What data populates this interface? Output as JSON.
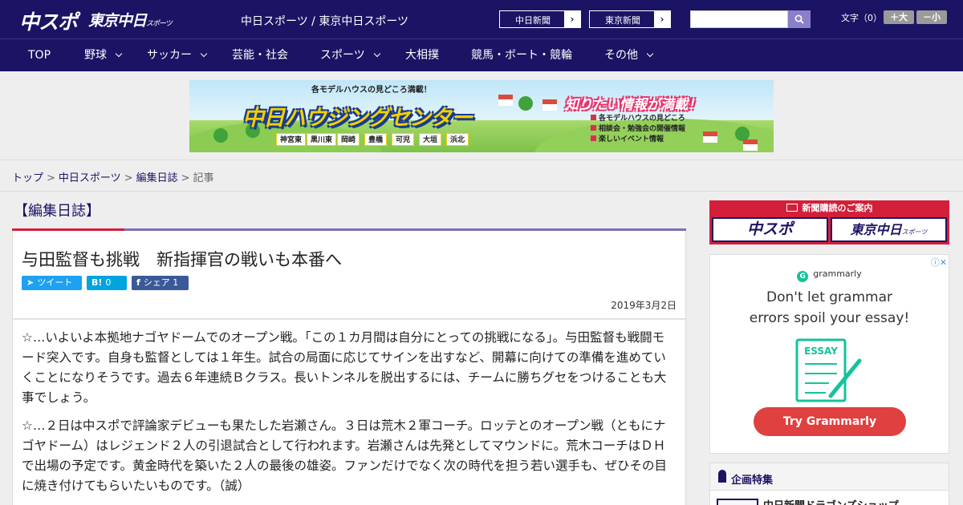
{
  "header": {
    "logo_chuspo": "中スポ",
    "logo_tokyo_main": "東京中日",
    "logo_tokyo_sub": "スポーツ",
    "site_names": "中日スポーツ / 東京中日スポーツ",
    "paper_links": [
      "中日新聞",
      "東京新聞"
    ],
    "search_placeholder": "",
    "font_size_label": "文字（0）",
    "font_up": "＋大",
    "font_down": "－小"
  },
  "nav": {
    "items": [
      {
        "label": "TOP",
        "dropdown": false
      },
      {
        "label": "野球",
        "dropdown": true
      },
      {
        "label": "サッカー",
        "dropdown": true
      },
      {
        "label": "芸能・社会",
        "dropdown": false
      },
      {
        "label": "スポーツ",
        "dropdown": true
      },
      {
        "label": "大相撲",
        "dropdown": false
      },
      {
        "label": "競馬・ボート・競輪",
        "dropdown": false
      },
      {
        "label": "その他",
        "dropdown": true
      }
    ]
  },
  "banner": {
    "top_text": "各モデルハウスの見どころ満載！",
    "title": "中日ハウジングセンター",
    "catch": "知りたい情報が満載！",
    "list": [
      "各モデルハウスの見どころ",
      "相談会・勉強会の開催情報",
      "楽しいイベント情報"
    ],
    "cities": [
      "神宮東",
      "黒川東",
      "岡崎",
      "豊橋",
      "可児",
      "大垣",
      "浜北"
    ]
  },
  "breadcrumb": {
    "items": [
      "トップ",
      "中日スポーツ",
      "編集日誌"
    ],
    "current": "記事",
    "separator": ">"
  },
  "article": {
    "section": "【編集日誌】",
    "title": "与田監督も挑戦　新指揮官の戦いも本番へ",
    "share": {
      "tweet_label": "ツイート",
      "hatena_icon": "B!",
      "hatena_count": "0",
      "facebook_icon": "f",
      "facebook_label": "シェア",
      "facebook_count": "1"
    },
    "date": "2019年3月2日",
    "paragraphs": [
      "☆…いよいよ本拠地ナゴヤドームでのオープン戦。「この１カ月間は自分にとっての挑戦になる」。与田監督も戦闘モード突入です。自身も監督としては１年生。試合の局面に応じてサインを出すなど、開幕に向けての準備を進めていくことになりそうです。過去６年連続Ｂクラス。長いトンネルを脱出するには、チームに勝ちグセをつけることも大事でしょう。",
      "☆…２日は中スポで評論家デビューも果たした岩瀬さん。３日は荒木２軍コーチ。ロッテとのオープン戦（ともにナゴヤドーム）はレジェンド２人の引退試合として行われます。岩瀬さんは先発としてマウンドに。荒木コーチはＤＨで出場の予定です。黄金時代を築いた２人の最後の雄姿。ファンだけでなく次の時代を担う若い選手も、ぜひその目に焼き付けてもらいたいものです。（誠）"
    ]
  },
  "sidebar": {
    "subscribe_head": "新聞購読のご案内",
    "subscribe_links": [
      "中スポ",
      "東京中日"
    ],
    "subscribe_sub": "スポーツ",
    "ad": {
      "brand": "grammarly",
      "headline_1": "Don't let grammar",
      "headline_2": "errors spoil your essay!",
      "illust_text": "ESSAY",
      "cta": "Try Grammarly"
    },
    "feature_title": "企画特集",
    "feature_item": "中日新聞ドラゴンズショップ"
  },
  "colors": {
    "header_bg": "#1b1464",
    "accent_red": "#d31f3a",
    "section_line": "#7a71b5",
    "twitter": "#1da1f2",
    "hatena": "#00a4de",
    "facebook": "#3b5998",
    "ad_cta": "#e0403f"
  }
}
